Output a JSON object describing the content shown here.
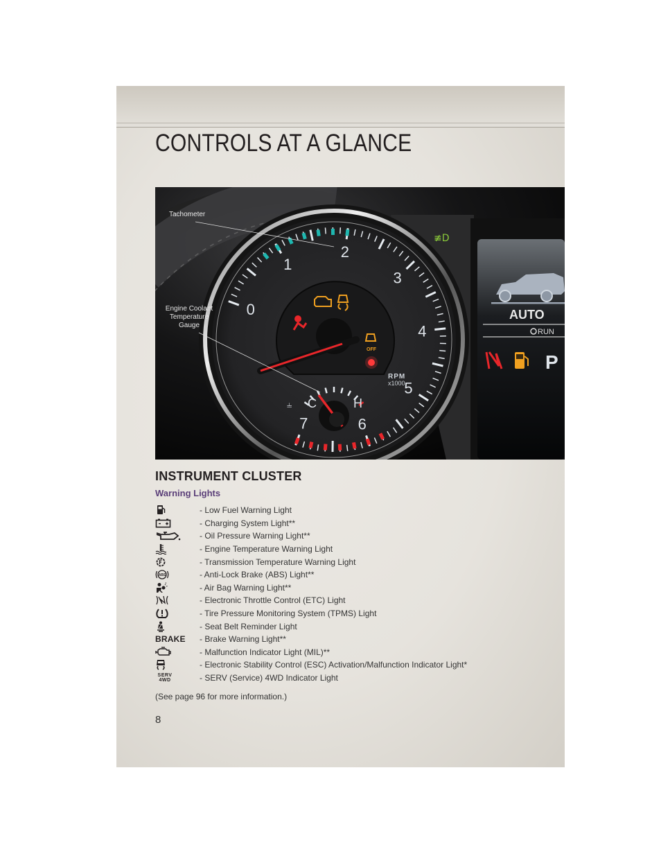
{
  "page": {
    "title": "CONTROLS AT A GLANCE",
    "page_number": "8"
  },
  "photo": {
    "callouts": {
      "tachometer": "Tachometer",
      "coolant_gauge": [
        "Engine Coolant",
        "Temperature",
        "Gauge"
      ]
    },
    "tach_numbers": [
      "0",
      "1",
      "2",
      "3",
      "4",
      "5",
      "6",
      "7"
    ],
    "rpm_label": "RPM",
    "rpm_multiplier": "x1000",
    "temp_cold": "C",
    "temp_hot": "H",
    "esc_off_label": "OFF",
    "display": {
      "mode": "AUTO",
      "run_label": "RUN",
      "gear": "P"
    },
    "colors": {
      "amber": "#f0a020",
      "red": "#e8262a",
      "teal": "#1fb7b0",
      "green": "#8ccc3a"
    }
  },
  "section": {
    "heading": "INSTRUMENT CLUSTER",
    "subheading": "Warning Lights"
  },
  "warning_lights": [
    {
      "icon": "fuel-pump-icon",
      "label": "- Low Fuel Warning Light"
    },
    {
      "icon": "battery-icon",
      "label": "- Charging System Light**"
    },
    {
      "icon": "oil-can-icon",
      "label": "- Oil Pressure Warning Light**"
    },
    {
      "icon": "coolant-temperature-icon",
      "label": "- Engine Temperature Warning Light"
    },
    {
      "icon": "transmission-temperature-icon",
      "label": "- Transmission Temperature Warning Light"
    },
    {
      "icon": "abs-icon",
      "label": "- Anti-Lock Brake (ABS) Light**"
    },
    {
      "icon": "airbag-icon",
      "label": "- Air Bag Warning Light**"
    },
    {
      "icon": "throttle-control-icon",
      "label": "- Electronic Throttle Control (ETC) Light"
    },
    {
      "icon": "tire-pressure-icon",
      "label": "- Tire Pressure Monitoring System (TPMS) Light"
    },
    {
      "icon": "seat-belt-icon",
      "label": "- Seat Belt Reminder Light"
    },
    {
      "icon": "brake-text-icon",
      "icon_text": "BRAKE",
      "label": "- Brake Warning Light**"
    },
    {
      "icon": "check-engine-icon",
      "label": "- Malfunction Indicator Light (MIL)**"
    },
    {
      "icon": "stability-control-icon",
      "label": "- Electronic Stability Control (ESC) Activation/Malfunction Indicator Light*"
    },
    {
      "icon": "serv-4wd-icon",
      "icon_text": [
        "SERV",
        "4WD"
      ],
      "label": "- SERV (Service) 4WD Indicator Light"
    }
  ],
  "footnote": "(See page 96 for more information.)"
}
